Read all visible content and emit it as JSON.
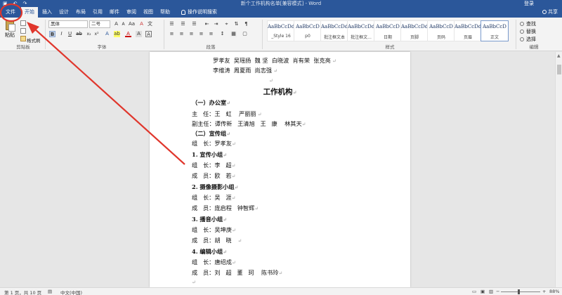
{
  "titlebar": {
    "title": "新个工作机构名单[兼容模式] - Word",
    "user": "登录"
  },
  "tabs": [
    {
      "label": "文件"
    },
    {
      "label": "开始"
    },
    {
      "label": "插入"
    },
    {
      "label": "设计"
    },
    {
      "label": "布局"
    },
    {
      "label": "引用"
    },
    {
      "label": "邮件"
    },
    {
      "label": "审阅"
    },
    {
      "label": "视图"
    },
    {
      "label": "帮助"
    }
  ],
  "tellme": "操作说明搜索",
  "share": "共享",
  "ribbon": {
    "clipboard": {
      "paste": "粘贴",
      "format_painter": "格式刷",
      "label": "剪贴板"
    },
    "font": {
      "name": "黑体",
      "size": "二号",
      "label": "字体",
      "bold": "B",
      "italic": "I",
      "underline": "U",
      "grow": "A",
      "shrink": "A",
      "aa": "Aa",
      "clear": "A",
      "wen": "文"
    },
    "paragraph": {
      "label": "段落"
    },
    "styles": {
      "label": "样式",
      "items": [
        {
          "sample": "AaBbCcDd",
          "name": "_Style 16"
        },
        {
          "sample": "AaBbCcD",
          "name": "p0"
        },
        {
          "sample": "AaBbCcDdl",
          "name": "批注框文本"
        },
        {
          "sample": "AaBbCcDdl",
          "name": "批注框文..."
        },
        {
          "sample": "AaBbCcD",
          "name": "日期"
        },
        {
          "sample": "AaBbCcDdl",
          "name": "页脚"
        },
        {
          "sample": "AaBbCcD",
          "name": "页码"
        },
        {
          "sample": "AaBbCcDdl",
          "name": "页眉"
        },
        {
          "sample": "AaBbCcD",
          "name": "正文"
        }
      ]
    },
    "editing": {
      "find": "查找",
      "replace": "替换",
      "select": "选择",
      "label": "编辑"
    }
  },
  "document": {
    "lines": [
      "罗孝友  吴瑶扬  魏 坚  白晓波  肖有荣  张克亮",
      "李维涛  周夏雨  尚志强",
      "",
      "工作机构",
      "（一）办公室",
      "主   任：王   虹    严丽丽",
      "副主任：谭传新   王清旭   王   康    林其天",
      "（二）宣传组",
      "组   长：罗孝友",
      "1. 宣传小组",
      "组   长：李   超",
      "成   员：欧   若",
      "2. 摄像摄影小组",
      "组   长：吴   涯",
      "成   员：庞启程   钟智辉",
      "3. 播音小组",
      "组   长：吴坤庚",
      "成   员：胡   晓",
      "4. 编辑小组",
      "组   长：唐绍成",
      "成   员：刘   超   董   珂    陈书玲"
    ]
  },
  "status": {
    "page": "第 1 页，共 10 页",
    "lang": "中文(中国)",
    "zoom": "88%"
  },
  "colors": {
    "ribbon_blue": "#2b579a",
    "annotation_red": "#e0362c"
  }
}
